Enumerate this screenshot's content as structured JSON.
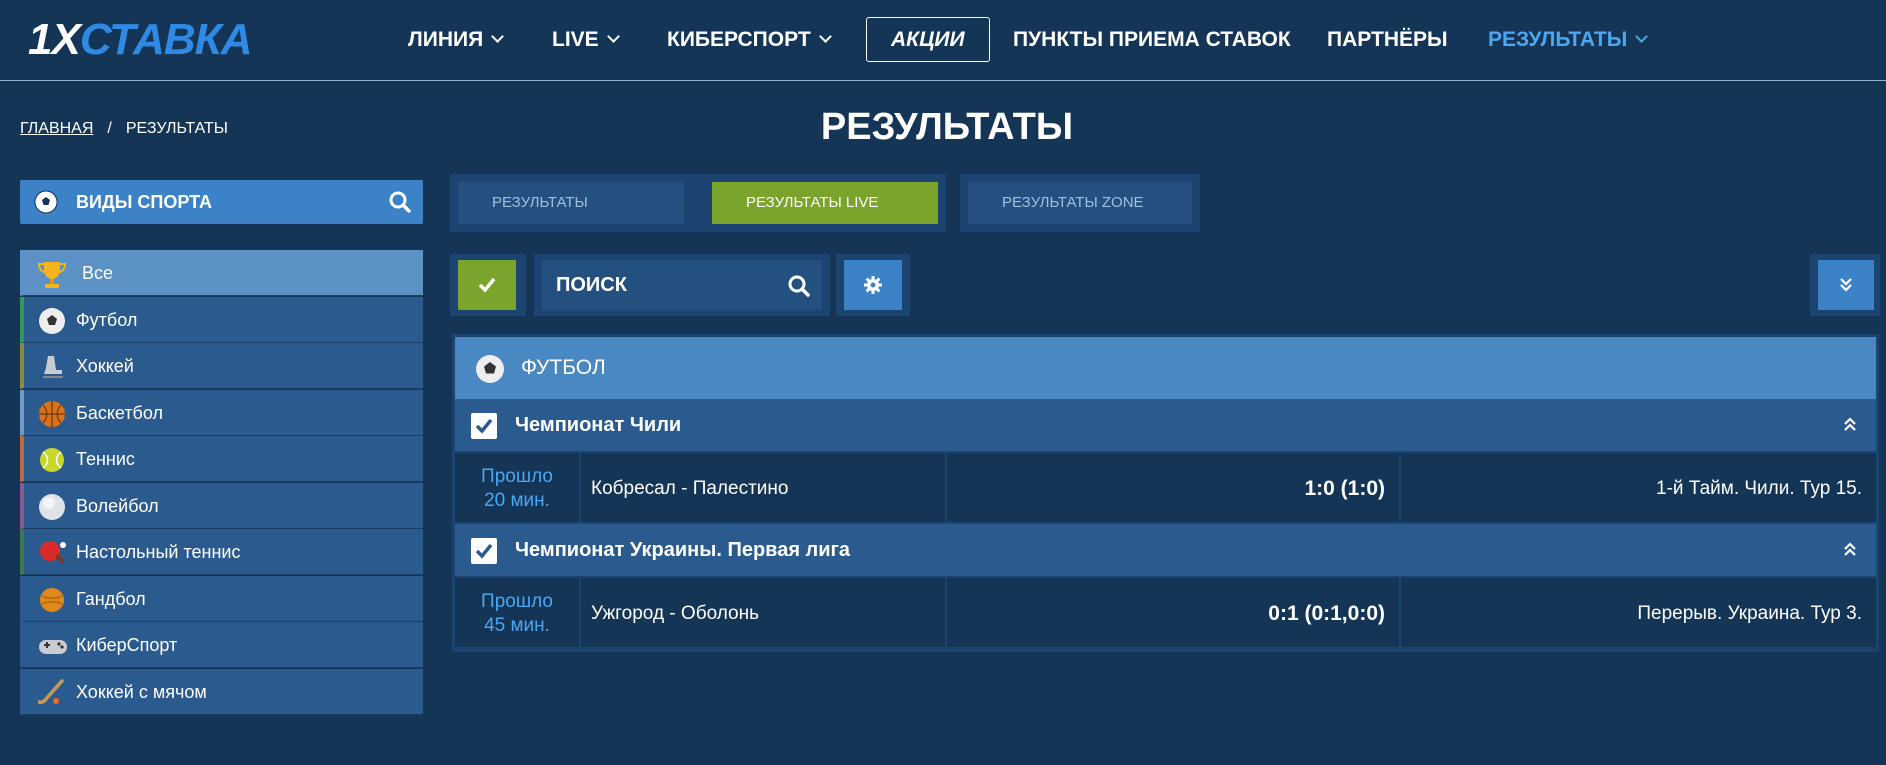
{
  "header": {
    "logo_part1": "1X",
    "logo_part2": "СТАВКА",
    "nav": {
      "line": "ЛИНИЯ",
      "live": "LIVE",
      "esports": "КИБЕРСПОРТ",
      "promo": "АКЦИИ",
      "points": "ПУНКТЫ ПРИЕМА СТАВОК",
      "partners": "ПАРТНЁРЫ",
      "results": "РЕЗУЛЬТАТЫ"
    }
  },
  "breadcrumb": {
    "home": "ГЛАВНАЯ",
    "sep": "/",
    "current": "РЕЗУЛЬТАТЫ"
  },
  "page_title": "РЕЗУЛЬТАТЫ",
  "sidebar": {
    "header": "ВИДЫ СПОРТА",
    "items": [
      {
        "label": "Все",
        "icon": "trophy-icon"
      },
      {
        "label": "Футбол",
        "icon": "soccer-ball-icon",
        "accent": "#2f9a5a"
      },
      {
        "label": "Хоккей",
        "icon": "skate-icon",
        "accent": "#8d8a3c"
      },
      {
        "label": "Баскетбол",
        "icon": "basketball-icon",
        "accent": "#6f9cc3"
      },
      {
        "label": "Теннис",
        "icon": "tennis-ball-icon",
        "accent": "#c36a3c"
      },
      {
        "label": "Волейбол",
        "icon": "volleyball-icon",
        "accent": "#8b5a8e"
      },
      {
        "label": "Настольный теннис",
        "icon": "table-tennis-icon",
        "accent": "#3c7a4a"
      },
      {
        "label": "Гандбол",
        "icon": "handball-icon",
        "accent": "#2b5b8e"
      },
      {
        "label": "КиберСпорт",
        "icon": "gamepad-icon",
        "accent": "#2b5b8e"
      },
      {
        "label": "Хоккей с мячом",
        "icon": "bandy-stick-icon",
        "accent": "#2b5b8e"
      }
    ]
  },
  "tabs": [
    {
      "label": "РЕЗУЛЬТАТЫ"
    },
    {
      "label": "РЕЗУЛЬТАТЫ LIVE"
    },
    {
      "label": "РЕЗУЛЬТАТЫ ZONE"
    }
  ],
  "toolbar": {
    "search_label": "ПОИСК"
  },
  "results": {
    "sport": "ФУТБОЛ",
    "championships": [
      {
        "name": "Чемпионат Чили",
        "matches": [
          {
            "status_line1": "Прошло",
            "status_line2": "20 мин.",
            "teams": "Кобресал - Палестино",
            "score": "1:0 (1:0)",
            "info": "1-й Тайм. Чили. Тур 15."
          }
        ]
      },
      {
        "name": "Чемпионат Украины. Первая лига",
        "matches": [
          {
            "status_line1": "Прошло",
            "status_line2": "45 мин.",
            "teams": "Ужгород - Оболонь",
            "score": "0:1 (0:1,0:0)",
            "info": "Перерыв. Украина. Тур 3."
          }
        ]
      }
    ]
  },
  "colors": {
    "bg": "#143555",
    "accent_blue": "#3b82c6",
    "accent_green": "#7aa42c",
    "link_blue": "#4aa7f2"
  }
}
